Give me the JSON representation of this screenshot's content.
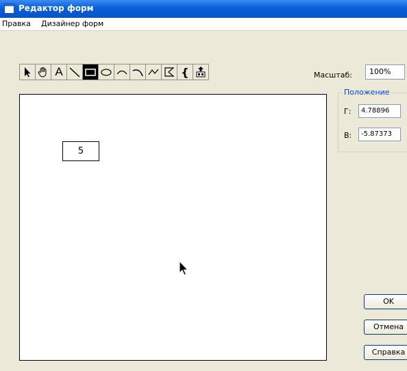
{
  "window": {
    "title": "Редактор форм"
  },
  "menu": {
    "items": [
      "Правка",
      "Дизайнер форм"
    ]
  },
  "toolbar": {
    "tools": [
      {
        "icon": "select-arrow-icon"
      },
      {
        "icon": "hand-pan-icon"
      },
      {
        "icon": "text-tool-icon",
        "glyph": "A"
      },
      {
        "icon": "line-tool-icon"
      },
      {
        "icon": "rectangle-tool-icon",
        "selected": true
      },
      {
        "icon": "ellipse-tool-icon"
      },
      {
        "icon": "arc-tool-icon"
      },
      {
        "icon": "curve-tool-icon"
      },
      {
        "icon": "polyline-tool-icon"
      },
      {
        "icon": "polygon-tool-icon"
      },
      {
        "icon": "brace-tool-icon",
        "glyph": "{"
      },
      {
        "icon": "image-insert-icon"
      }
    ]
  },
  "scale": {
    "label": "Масштаб:",
    "value": "100%"
  },
  "position": {
    "legend": "Положение",
    "h_label": "Г:",
    "h_value": "4.78896",
    "v_label": "В:",
    "v_value": "-5.87373"
  },
  "canvas": {
    "box_text": "5"
  },
  "buttons": {
    "ok": "OK",
    "cancel": "Отмена",
    "help": "Справка"
  }
}
